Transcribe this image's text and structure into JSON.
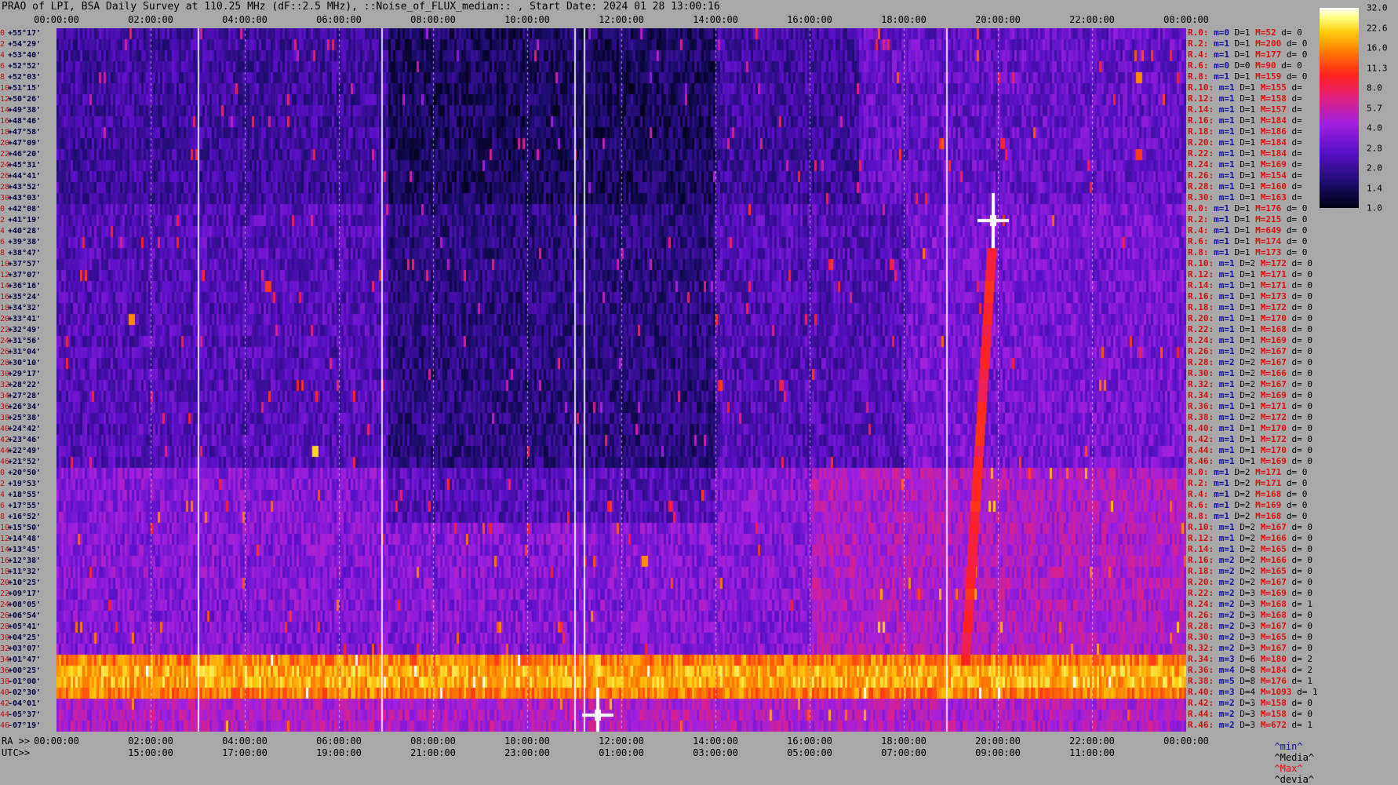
{
  "title": "PRAO of LPI, BSA Daily Survey at 110.25 MHz (dF::2.5 MHz), ::Noise_of_FLUX_median:: , Start Date: 2024 01 28 13:00:16",
  "chart_data": {
    "type": "heatmap",
    "top_ticks": [
      "00:00:00",
      "02:00:00",
      "04:00:00",
      "06:00:00",
      "08:00:00",
      "10:00:00",
      "12:00:00",
      "14:00:00",
      "16:00:00",
      "18:00:00",
      "20:00:00",
      "22:00:00",
      "00:00:00"
    ],
    "ra_prefix": "RA >>",
    "ra_ticks": [
      "00:00:00",
      "02:00:00",
      "04:00:00",
      "06:00:00",
      "08:00:00",
      "10:00:00",
      "12:00:00",
      "14:00:00",
      "16:00:00",
      "18:00:00",
      "20:00:00",
      "22:00:00",
      "00:00:00"
    ],
    "utc_prefix": "UTC>>",
    "utc_ticks": [
      "15:00:00",
      "17:00:00",
      "19:00:00",
      "21:00:00",
      "23:00:00",
      "01:00:00",
      "03:00:00",
      "05:00:00",
      "07:00:00",
      "09:00:00",
      "11:00:00"
    ],
    "declinations": [
      "+55°17'",
      "+54°29'",
      "+53°40'",
      "+52°52'",
      "+52°03'",
      "+51°15'",
      "+50°26'",
      "+49°38'",
      "+48°46'",
      "+47°58'",
      "+47°09'",
      "+46°20'",
      "+45°31'",
      "+44°41'",
      "+43°52'",
      "+43°03'",
      "+42°08'",
      "+41°19'",
      "+40°28'",
      "+39°38'",
      "+38°47'",
      "+37°57'",
      "+37°07'",
      "+36°16'",
      "+35°24'",
      "+34°32'",
      "+33°41'",
      "+32°49'",
      "+31°56'",
      "+31°04'",
      "+30°10'",
      "+29°17'",
      "+28°22'",
      "+27°28'",
      "+26°34'",
      "+25°38'",
      "+24°42'",
      "+23°46'",
      "+22°49'",
      "+21°52'",
      "+20°50'",
      "+19°53'",
      "+18°55'",
      "+17°55'",
      "+16°52'",
      "+15°50'",
      "+14°48'",
      "+13°45'",
      "+12°38'",
      "+11°32'",
      "+10°25'",
      "+09°17'",
      "+08°05'",
      "+06°54'",
      "+05°41'",
      "+04°25'",
      "+03°07'",
      "+01°47'",
      "+00°25'",
      "-01°00'",
      "-02°30'",
      "-04°01'",
      "-05°37'",
      "-07°19'"
    ],
    "row_numbers": [
      "0",
      "2",
      "4",
      "6",
      "8",
      "10",
      "12",
      "14",
      "16",
      "18",
      "20",
      "22",
      "24",
      "26",
      "28",
      "30",
      "0",
      "2",
      "4",
      "6",
      "8",
      "10",
      "12",
      "14",
      "16",
      "18",
      "20",
      "22",
      "24",
      "26",
      "28",
      "30",
      "32",
      "34",
      "36",
      "38",
      "40",
      "42",
      "44",
      "46",
      "0",
      "2",
      "4",
      "6",
      "8",
      "10",
      "12",
      "14",
      "16",
      "18",
      "20",
      "22",
      "24",
      "26",
      "28",
      "30",
      "32",
      "34",
      "36",
      "38",
      "40",
      "42",
      "44",
      "46"
    ],
    "colorbar_ticks": [
      "32.0",
      "22.6",
      "16.0",
      "11.3",
      "8.0",
      "5.7",
      "4.0",
      "2.8",
      "2.0",
      "1.4",
      "1.0"
    ],
    "colorbar_range": [
      1.0,
      32.0
    ],
    "colorbar_scale": "log",
    "bright_band_rows": [
      57,
      58,
      59,
      60
    ],
    "bright_sources": [
      {
        "ra_hours": 19.9,
        "row": 17,
        "level": 32
      },
      {
        "ra_hours": 11.5,
        "row": 62,
        "level": 32
      },
      {
        "ra_hours": 11.5,
        "row": 57,
        "level": 22
      },
      {
        "ra_hours": 5.5,
        "row": 38,
        "level": 22
      },
      {
        "ra_hours": 12.5,
        "row": 48,
        "level": 16
      },
      {
        "ra_hours": 1.6,
        "row": 26,
        "level": 16
      },
      {
        "ra_hours": 4.5,
        "row": 23,
        "level": 11
      },
      {
        "ra_hours": 23.0,
        "row": 4,
        "level": 16
      },
      {
        "ra_hours": 23.0,
        "row": 11,
        "level": 11
      }
    ]
  },
  "legend_rows": [
    {
      "r": "R.0:",
      "m": "m=0",
      "D": "D=1",
      "M": "M=52",
      "d": "d= 0"
    },
    {
      "r": "R.2:",
      "m": "m=1",
      "D": "D=1",
      "M": "M=200",
      "d": "d= 0"
    },
    {
      "r": "R.4:",
      "m": "m=1",
      "D": "D=1",
      "M": "M=177",
      "d": "d= 0"
    },
    {
      "r": "R.6:",
      "m": "m=0",
      "D": "D=0",
      "M": "M=90",
      "d": "d= 0"
    },
    {
      "r": "R.8:",
      "m": "m=1",
      "D": "D=1",
      "M": "M=159",
      "d": "d= 0"
    },
    {
      "r": "R.10:",
      "m": "m=1",
      "D": "D=1",
      "M": "M=155",
      "d": "d="
    },
    {
      "r": "R.12:",
      "m": "m=1",
      "D": "D=1",
      "M": "M=158",
      "d": "d="
    },
    {
      "r": "R.14:",
      "m": "m=1",
      "D": "D=1",
      "M": "M=157",
      "d": "d="
    },
    {
      "r": "R.16:",
      "m": "m=1",
      "D": "D=1",
      "M": "M=184",
      "d": "d="
    },
    {
      "r": "R.18:",
      "m": "m=1",
      "D": "D=1",
      "M": "M=186",
      "d": "d="
    },
    {
      "r": "R.20:",
      "m": "m=1",
      "D": "D=1",
      "M": "M=184",
      "d": "d="
    },
    {
      "r": "R.22:",
      "m": "m=1",
      "D": "D=1",
      "M": "M=184",
      "d": "d="
    },
    {
      "r": "R.24:",
      "m": "m=1",
      "D": "D=1",
      "M": "M=169",
      "d": "d="
    },
    {
      "r": "R.26:",
      "m": "m=1",
      "D": "D=1",
      "M": "M=154",
      "d": "d="
    },
    {
      "r": "R.28:",
      "m": "m=1",
      "D": "D=1",
      "M": "M=160",
      "d": "d="
    },
    {
      "r": "R.30:",
      "m": "m=1",
      "D": "D=1",
      "M": "M=163",
      "d": "d="
    },
    {
      "r": "R.0:",
      "m": "m=1",
      "D": "D=1",
      "M": "M=176",
      "d": "d= 0"
    },
    {
      "r": "R.2:",
      "m": "m=1",
      "D": "D=1",
      "M": "M=215",
      "d": "d= 0"
    },
    {
      "r": "R.4:",
      "m": "m=1",
      "D": "D=1",
      "M": "M=649",
      "d": "d= 0"
    },
    {
      "r": "R.6:",
      "m": "m=1",
      "D": "D=1",
      "M": "M=174",
      "d": "d= 0"
    },
    {
      "r": "R.8:",
      "m": "m=1",
      "D": "D=1",
      "M": "M=173",
      "d": "d= 0"
    },
    {
      "r": "R.10:",
      "m": "m=1",
      "D": "D=2",
      "M": "M=172",
      "d": "d= 0"
    },
    {
      "r": "R.12:",
      "m": "m=1",
      "D": "D=1",
      "M": "M=171",
      "d": "d= 0"
    },
    {
      "r": "R.14:",
      "m": "m=1",
      "D": "D=1",
      "M": "M=171",
      "d": "d= 0"
    },
    {
      "r": "R.16:",
      "m": "m=1",
      "D": "D=1",
      "M": "M=173",
      "d": "d= 0"
    },
    {
      "r": "R.18:",
      "m": "m=1",
      "D": "D=1",
      "M": "M=172",
      "d": "d= 0"
    },
    {
      "r": "R.20:",
      "m": "m=1",
      "D": "D=1",
      "M": "M=170",
      "d": "d= 0"
    },
    {
      "r": "R.22:",
      "m": "m=1",
      "D": "D=1",
      "M": "M=168",
      "d": "d= 0"
    },
    {
      "r": "R.24:",
      "m": "m=1",
      "D": "D=1",
      "M": "M=169",
      "d": "d= 0"
    },
    {
      "r": "R.26:",
      "m": "m=1",
      "D": "D=2",
      "M": "M=167",
      "d": "d= 0"
    },
    {
      "r": "R.28:",
      "m": "m=2",
      "D": "D=2",
      "M": "M=167",
      "d": "d= 0"
    },
    {
      "r": "R.30:",
      "m": "m=1",
      "D": "D=2",
      "M": "M=166",
      "d": "d= 0"
    },
    {
      "r": "R.32:",
      "m": "m=1",
      "D": "D=2",
      "M": "M=167",
      "d": "d= 0"
    },
    {
      "r": "R.34:",
      "m": "m=1",
      "D": "D=2",
      "M": "M=169",
      "d": "d= 0"
    },
    {
      "r": "R.36:",
      "m": "m=1",
      "D": "D=1",
      "M": "M=171",
      "d": "d= 0"
    },
    {
      "r": "R.38:",
      "m": "m=1",
      "D": "D=2",
      "M": "M=172",
      "d": "d= 0"
    },
    {
      "r": "R.40:",
      "m": "m=1",
      "D": "D=1",
      "M": "M=170",
      "d": "d= 0"
    },
    {
      "r": "R.42:",
      "m": "m=1",
      "D": "D=1",
      "M": "M=172",
      "d": "d= 0"
    },
    {
      "r": "R.44:",
      "m": "m=1",
      "D": "D=1",
      "M": "M=170",
      "d": "d= 0"
    },
    {
      "r": "R.46:",
      "m": "m=1",
      "D": "D=1",
      "M": "M=169",
      "d": "d= 0"
    },
    {
      "r": "R.0:",
      "m": "m=1",
      "D": "D=2",
      "M": "M=171",
      "d": "d= 0"
    },
    {
      "r": "R.2:",
      "m": "m=1",
      "D": "D=2",
      "M": "M=171",
      "d": "d= 0"
    },
    {
      "r": "R.4:",
      "m": "m=1",
      "D": "D=2",
      "M": "M=168",
      "d": "d= 0"
    },
    {
      "r": "R.6:",
      "m": "m=1",
      "D": "D=2",
      "M": "M=169",
      "d": "d= 0"
    },
    {
      "r": "R.8:",
      "m": "m=1",
      "D": "D=2",
      "M": "M=168",
      "d": "d= 0"
    },
    {
      "r": "R.10:",
      "m": "m=1",
      "D": "D=2",
      "M": "M=167",
      "d": "d= 0"
    },
    {
      "r": "R.12:",
      "m": "m=1",
      "D": "D=2",
      "M": "M=166",
      "d": "d= 0"
    },
    {
      "r": "R.14:",
      "m": "m=1",
      "D": "D=2",
      "M": "M=165",
      "d": "d= 0"
    },
    {
      "r": "R.16:",
      "m": "m=2",
      "D": "D=2",
      "M": "M=166",
      "d": "d= 0"
    },
    {
      "r": "R.18:",
      "m": "m=2",
      "D": "D=2",
      "M": "M=165",
      "d": "d= 0"
    },
    {
      "r": "R.20:",
      "m": "m=2",
      "D": "D=2",
      "M": "M=167",
      "d": "d= 0"
    },
    {
      "r": "R.22:",
      "m": "m=2",
      "D": "D=3",
      "M": "M=169",
      "d": "d= 0"
    },
    {
      "r": "R.24:",
      "m": "m=2",
      "D": "D=3",
      "M": "M=168",
      "d": "d= 1"
    },
    {
      "r": "R.26:",
      "m": "m=2",
      "D": "D=3",
      "M": "M=168",
      "d": "d= 0"
    },
    {
      "r": "R.28:",
      "m": "m=2",
      "D": "D=3",
      "M": "M=167",
      "d": "d= 0"
    },
    {
      "r": "R.30:",
      "m": "m=2",
      "D": "D=3",
      "M": "M=165",
      "d": "d= 0"
    },
    {
      "r": "R.32:",
      "m": "m=2",
      "D": "D=3",
      "M": "M=167",
      "d": "d= 0"
    },
    {
      "r": "R.34:",
      "m": "m=3",
      "D": "D=6",
      "M": "M=180",
      "d": "d= 2"
    },
    {
      "r": "R.36:",
      "m": "m=4",
      "D": "D=8",
      "M": "M=184",
      "d": "d= 2"
    },
    {
      "r": "R.38:",
      "m": "m=5",
      "D": "D=8",
      "M": "M=176",
      "d": "d= 1"
    },
    {
      "r": "R.40:",
      "m": "m=3",
      "D": "D=4",
      "M": "M=1093",
      "d": "d= 1"
    },
    {
      "r": "R.42:",
      "m": "m=2",
      "D": "D=3",
      "M": "M=158",
      "d": "d= 0"
    },
    {
      "r": "R.44:",
      "m": "m=2",
      "D": "D=3",
      "M": "M=158",
      "d": "d= 0"
    },
    {
      "r": "R.46:",
      "m": "m=2",
      "D": "D=3",
      "M": "M=672",
      "d": "d= 1"
    }
  ],
  "footer_legend": {
    "min": "^min^",
    "media": "^Media^",
    "max": "^Max^",
    "devia": "^devia^"
  }
}
